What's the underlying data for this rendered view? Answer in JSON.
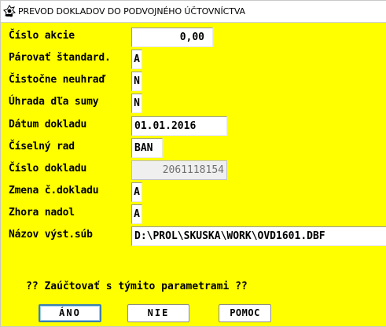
{
  "window": {
    "title": "PREVOD DOKLADOV DO PODVOJNÉHO ÚČTOVNÍCTVA",
    "icon": "app-icon"
  },
  "form": {
    "fields": [
      {
        "label": "Číslo akcie",
        "value": "0,00"
      },
      {
        "label": "Párovať štandard.",
        "value": "A"
      },
      {
        "label": "Čistočne neuhraď",
        "value": "N"
      },
      {
        "label": "Úhrada dľa sumy",
        "value": "N"
      },
      {
        "label": "Dátum dokladu",
        "value": "01.01.2016"
      },
      {
        "label": "Číselný rad",
        "value": "BAN"
      },
      {
        "label": "Číslo dokladu",
        "value": "2061118154"
      },
      {
        "label": "Zmena č.dokladu",
        "value": "A"
      },
      {
        "label": "Zhora nadol",
        "value": "A"
      },
      {
        "label": "Názov výst.súb",
        "value": "D:\\PROL\\SKUSKA\\WORK\\OVD1601.DBF"
      }
    ]
  },
  "prompt": "?? Zaúčtovať s týmito parametrami ??",
  "buttons": {
    "yes": "ÁNO",
    "no": "NIE",
    "help": "POMOC"
  },
  "colors": {
    "background": "#ffff00",
    "default_button_border": "#3c7fb1"
  }
}
